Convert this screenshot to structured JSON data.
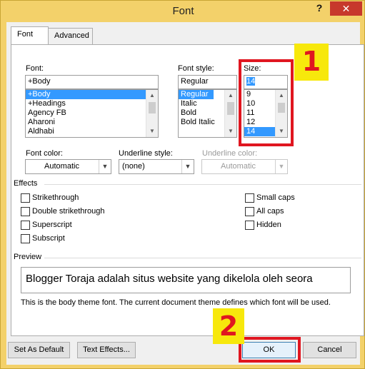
{
  "window": {
    "title": "Font",
    "help_glyph": "?",
    "close_glyph": "✕"
  },
  "tabs": [
    {
      "label": "Font"
    },
    {
      "label": "Advanced"
    }
  ],
  "font": {
    "label": "Font:",
    "value": "+Body",
    "items": [
      "+Body",
      "+Headings",
      "Agency FB",
      "Aharoni",
      "Aldhabi"
    ],
    "selected": "+Body"
  },
  "font_style": {
    "label": "Font style:",
    "value": "Regular",
    "items": [
      "Regular",
      "Italic",
      "Bold",
      "Bold Italic"
    ],
    "selected": "Regular"
  },
  "size": {
    "label": "Size:",
    "value": "14",
    "items": [
      "9",
      "10",
      "11",
      "12",
      "14"
    ],
    "selected": "14"
  },
  "font_color": {
    "label": "Font color:",
    "value": "Automatic"
  },
  "underline_style": {
    "label": "Underline style:",
    "value": "(none)"
  },
  "underline_color": {
    "label": "Underline color:",
    "value": "Automatic"
  },
  "effects": {
    "heading": "Effects",
    "left": [
      "Strikethrough",
      "Double strikethrough",
      "Superscript",
      "Subscript"
    ],
    "right": [
      "Small caps",
      "All caps",
      "Hidden"
    ]
  },
  "preview": {
    "heading": "Preview",
    "text": "Blogger Toraja adalah situs website yang dikelola oleh seora",
    "note": "This is the body theme font. The current document theme defines which font will be used."
  },
  "buttons": {
    "set_default": "Set As Default",
    "text_effects": "Text Effects...",
    "ok": "OK",
    "cancel": "Cancel"
  },
  "annotations": {
    "callout_1": "1",
    "callout_2": "2",
    "color": "#e01620",
    "badge_color": "#f7e80c"
  }
}
